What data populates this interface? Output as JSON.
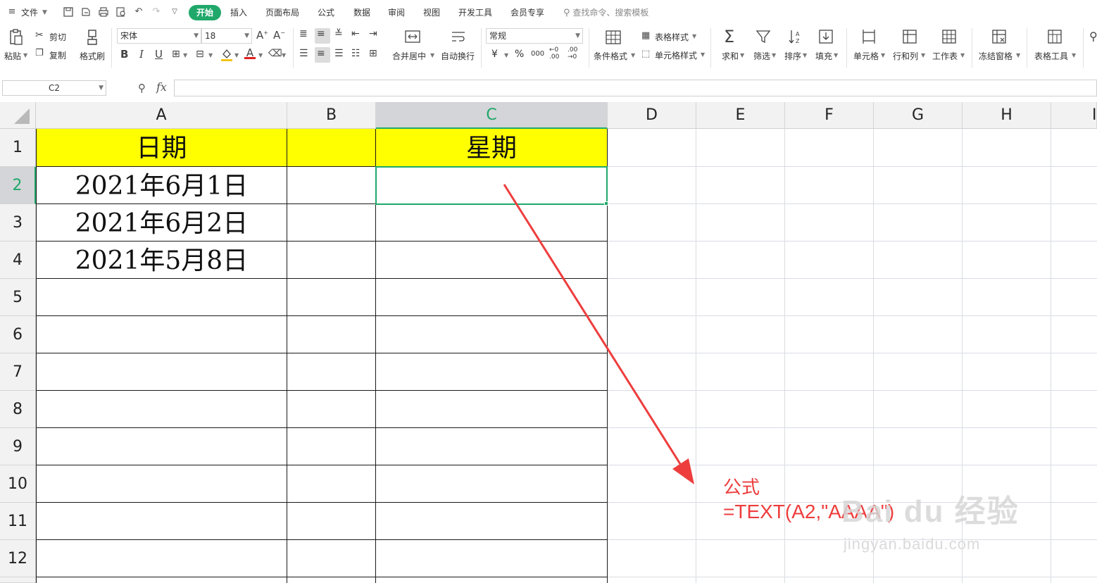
{
  "menu": {
    "file": "文件",
    "tabs": [
      "开始",
      "插入",
      "页面布局",
      "公式",
      "数据",
      "审阅",
      "视图",
      "开发工具",
      "会员专享"
    ],
    "active_tab": "开始",
    "search_placeholder": "查找命令、搜索模板",
    "accent_color": "#1fa86a"
  },
  "ribbon": {
    "paste": "粘贴",
    "cut": "剪切",
    "copy": "复制",
    "format_painter": "格式刷",
    "font_name": "宋体",
    "font_size": "18",
    "merge_center": "合并居中",
    "wrap_text": "自动换行",
    "number_format": "常规",
    "table_style": "表格样式",
    "cell_style": "单元格样式",
    "conditional_format": "条件格式",
    "sum": "求和",
    "filter": "筛选",
    "sort": "排序",
    "fill": "填充",
    "cell": "单元格",
    "row_col": "行和列",
    "worksheet": "工作表",
    "freeze": "冻结窗格",
    "table_tools": "表格工具",
    "currency": "¥",
    "percent": "%",
    "thousands": "000",
    "inc_decimal": "←0 .00",
    "dec_decimal": ".00 →0"
  },
  "formula_bar": {
    "name_box": "C2",
    "fx": "fx",
    "content": ""
  },
  "sheet": {
    "columns": [
      "A",
      "B",
      "C",
      "D",
      "E",
      "F",
      "G",
      "H",
      "I"
    ],
    "rows": [
      "1",
      "2",
      "3",
      "4",
      "5",
      "6",
      "7",
      "8",
      "9",
      "10",
      "11",
      "12"
    ],
    "active_cell": "C2",
    "cells": {
      "A1": "日期",
      "C1": "星期",
      "A2": "2021年6月1日",
      "A3": "2021年6月2日",
      "A4": "2021年5月8日"
    },
    "header_fill": "#ffff00"
  },
  "annotation": {
    "title": "公式",
    "formula": "=TEXT(A2,\"AAAA\")",
    "color": "#ee3d3d"
  },
  "watermark": {
    "brand": "Bai du 经验",
    "url": "jingyan.baidu.com"
  }
}
